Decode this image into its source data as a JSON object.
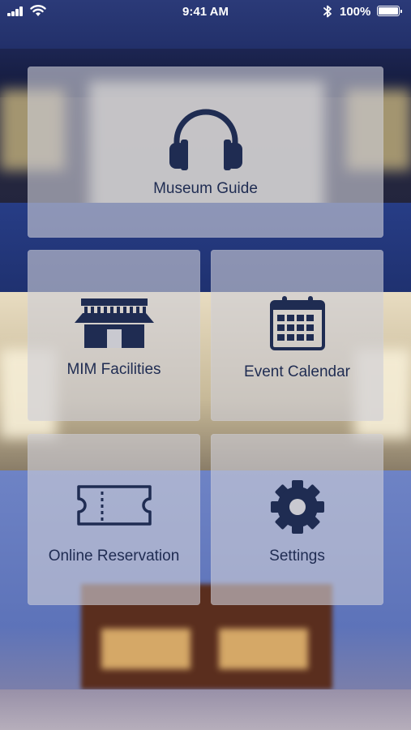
{
  "status_bar": {
    "time": "9:41 AM",
    "battery": "100%",
    "signal_icon": "cellular-signal-icon",
    "wifi_icon": "wifi-icon",
    "bluetooth_icon": "bluetooth-icon",
    "battery_icon": "battery-icon"
  },
  "menu": {
    "museum_guide": {
      "label": "Museum Guide",
      "icon": "headphones-icon"
    },
    "facilities": {
      "label": "MIM Facilities",
      "icon": "museum-building-icon"
    },
    "event_calendar": {
      "label": "Event Calendar",
      "icon": "calendar-icon"
    },
    "online_reservation": {
      "label": "Online Reservation",
      "icon": "ticket-icon"
    },
    "settings": {
      "label": "Settings",
      "icon": "gear-icon"
    }
  },
  "colors": {
    "icon_color": "#1f2c52",
    "tile_background": "rgba(205,205,214,0.62)",
    "status_text": "#ffffff"
  }
}
